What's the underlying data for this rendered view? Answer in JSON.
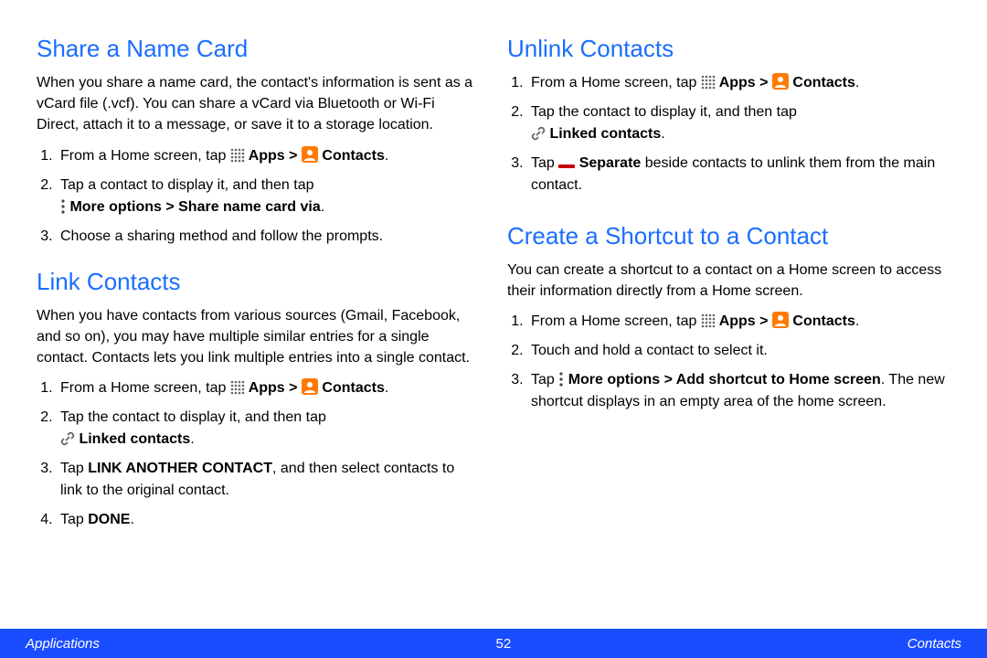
{
  "sections": {
    "share": {
      "heading": "Share a Name Card",
      "intro": "When you share a name card, the contact's information is sent as a vCard file (.vcf). You can share a vCard via Bluetooth or Wi-Fi Direct, attach it to a message, or save it to a storage location.",
      "step1a": "From a Home screen, tap ",
      "apps": " Apps > ",
      "contacts": " Contacts",
      "step2a": "Tap a contact to display it, and then tap ",
      "step2b": " More options > Share name card via",
      "step3": "Choose a sharing method and follow the prompts."
    },
    "link": {
      "heading": "Link Contacts",
      "intro": "When you have contacts from various sources (Gmail, Facebook, and so on), you may have multiple similar entries for a single contact. Contacts lets you link multiple entries into a single contact.",
      "step1a": "From a Home screen, tap ",
      "step2a": "Tap the contact to display it, and then tap ",
      "step2b": " Linked contacts",
      "step3a": "Tap ",
      "step3b": "LINK ANOTHER CONTACT",
      "step3c": ", and then select contacts to link to the original contact.",
      "step4a": "Tap ",
      "step4b": "DONE"
    },
    "unlink": {
      "heading": "Unlink Contacts",
      "step1a": "From a Home screen, tap ",
      "step2a": "Tap the contact to display it, and then tap ",
      "step2b": " Linked contacts",
      "step3a": "Tap ",
      "step3b": " Separate",
      "step3c": " beside contacts to unlink them from the main contact."
    },
    "shortcut": {
      "heading": "Create a Shortcut to a Contact",
      "intro": "You can create a shortcut to a contact on a Home screen to access their information directly from a Home screen.",
      "step1a": "From a Home screen, tap ",
      "step2": "Touch and hold a contact to select it.",
      "step3a": "Tap ",
      "step3b": " More options > Add shortcut to Home screen",
      "step3c": ". The new shortcut displays in an empty area of the home screen."
    }
  },
  "common": {
    "apps": " Apps > ",
    "contacts": " Contacts",
    "period": "."
  },
  "footer": {
    "left": "Applications",
    "center": "52",
    "right": "Contacts"
  }
}
